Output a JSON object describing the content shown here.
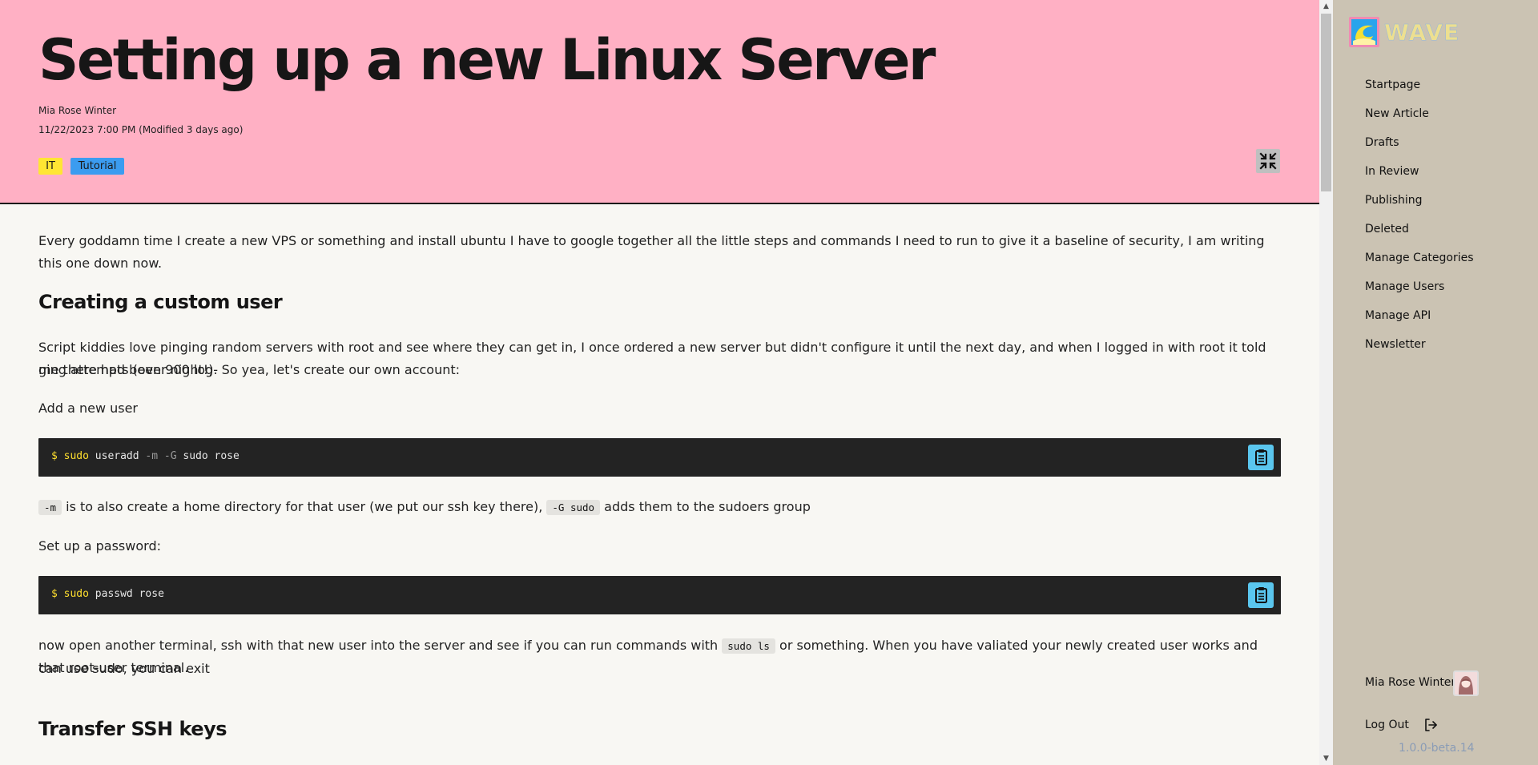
{
  "article": {
    "title": "Setting up a new Linux Server",
    "author": "Mia Rose Winter",
    "date": "11/22/2023 7:00 PM (Modified 3 days ago)",
    "tags": [
      "IT",
      "Tutorial"
    ],
    "intro": "Every goddamn time I create a new VPS or something and install ubuntu I have to google together all the little steps and commands I need to run to give it a baseline of security, I am writing this one down now.",
    "section1_heading": "Creating a custom user",
    "section1_para_line1": "Script kiddies love pinging random servers with root and see where they can get in, I once ordered a new server but didn't configure it until the next day, and when I logged in with root it told me there had been 900 log-",
    "section1_para_line2": "ging attempts (over night!). So yea, let's create our own account:",
    "add_user_label": "Add a new user",
    "code1_prompt": "$ sudo",
    "code1_cmd": "useradd",
    "code1_flags": "-m -G",
    "code1_rest": "sudo rose",
    "explain_code_m": "-m",
    "explain_text_1": " is to also create a home directory for that user (we put our ssh key there), ",
    "explain_code_g": "-G sudo",
    "explain_text_2": " adds them to the sudoers group",
    "password_label": "Set up a password:",
    "code2_prompt": "$ sudo",
    "code2_cmd": "passwd rose",
    "test_text_1": "now open another terminal, ssh with that new user into the server and see if you can run commands with ",
    "test_code": "sudo ls",
    "test_text_2": " or something. When you have valiated your newly created user works and can use sudo, you can exit",
    "test_text_line2": "that root-user terminal.",
    "section2_heading": "Transfer SSH keys"
  },
  "sidebar": {
    "logo_text": "WAVE",
    "nav": [
      {
        "label": "Startpage"
      },
      {
        "label": "New Article"
      },
      {
        "label": "Drafts"
      },
      {
        "label": "In Review"
      },
      {
        "label": "Publishing"
      },
      {
        "label": "Deleted"
      },
      {
        "label": "Manage Categories"
      },
      {
        "label": "Manage Users"
      },
      {
        "label": "Manage API"
      },
      {
        "label": "Newsletter"
      }
    ],
    "user_name": "Mia Rose Winter",
    "logout_label": "Log Out",
    "version": "1.0.0-beta.14"
  },
  "colors": {
    "header_bg": "#ffb0c4",
    "tag_it": "#ffe633",
    "tag_tutorial": "#3b9cf0",
    "code_bg": "#232323",
    "copy_button": "#5ac6ee",
    "sidebar_bg": "#cbc3b3"
  },
  "icons": {
    "collapse": "collapse-icon",
    "copy": "clipboard-icon",
    "logout": "logout-icon"
  }
}
